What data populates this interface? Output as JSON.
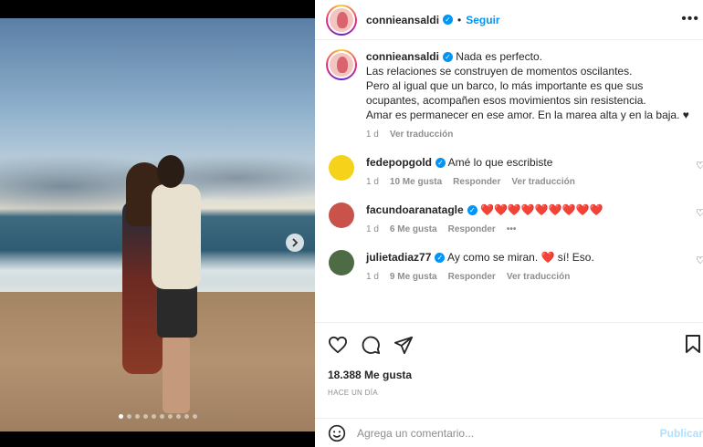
{
  "post": {
    "username": "connieansaldi",
    "follow_label": "Seguir",
    "more_label": "•••",
    "photo_count": 10,
    "active_photo": 1
  },
  "caption": {
    "username": "connieansaldi",
    "lines": [
      "Nada es perfecto.",
      "Las relaciones se construyen de momentos oscilantes.",
      "Pero al igual que un barco, lo más importante es que sus",
      "ocupantes, acompañen esos movimientos sin resistencia.",
      "Amar es permanecer en ese amor. En la marea alta y en la baja. ♥"
    ],
    "time": "1 d",
    "translate": "Ver traducción"
  },
  "comments": [
    {
      "username": "fedepopgold",
      "text": "Amé lo que escribiste",
      "time": "1 d",
      "likes": "10 Me gusta",
      "reply": "Responder",
      "translate": "Ver traducción",
      "avatar_color": "#f6d21a"
    },
    {
      "username": "facundoaranatagle",
      "text": "❤️❤️❤️❤️❤️❤️❤️❤️❤️",
      "time": "1 d",
      "likes": "6 Me gusta",
      "reply": "Responder",
      "more": "•••",
      "avatar_color": "#c9534a"
    },
    {
      "username": "julietadiaz77",
      "text": "Ay como se miran. ❤️ sí! Eso.",
      "time": "1 d",
      "likes": "9 Me gusta",
      "reply": "Responder",
      "translate": "Ver traducción",
      "avatar_color": "#4d6b45"
    }
  ],
  "stats": {
    "likes": "18.388 Me gusta",
    "ago": "HACE UN DÍA"
  },
  "add_comment": {
    "placeholder": "Agrega un comentario...",
    "publish": "Publicar"
  },
  "colors": {
    "accent": "#0095f6",
    "heart": "#ed4956",
    "muted": "#8e8e8e"
  }
}
